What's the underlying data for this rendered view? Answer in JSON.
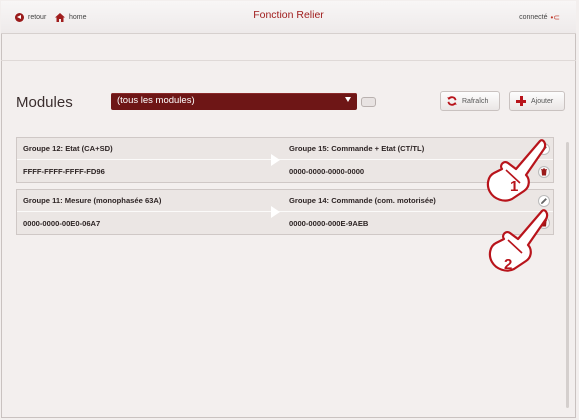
{
  "header": {
    "back_label": "retour",
    "home_label": "home",
    "title": "Fonction Relier",
    "status_label": "connecté"
  },
  "toolbar": {
    "modules_title": "Modules",
    "filter_select": "(tous les modules)",
    "refresh_label": "Rafraîch",
    "add_label": "Ajouter"
  },
  "links": [
    {
      "source_group": "Groupe 12: Etat (CA+SD)",
      "source_id": "FFFF-FFFF-FFFF-FD96",
      "target_group": "Groupe  15: Commande + Etat (CT/TL)",
      "target_id": "0000-0000-0000-0000"
    },
    {
      "source_group": "Groupe 11: Mesure (monophasée 63A)",
      "source_id": "0000-0000-00E0-06A7",
      "target_group": "Groupe 14: Commande (com. motorisée)",
      "target_id": "0000-0000-000E-9AEB"
    }
  ],
  "annotations": [
    "1",
    "2"
  ],
  "colors": {
    "accent": "#6e1616",
    "title": "#a01d1d",
    "delete": "#9a1a1a"
  }
}
